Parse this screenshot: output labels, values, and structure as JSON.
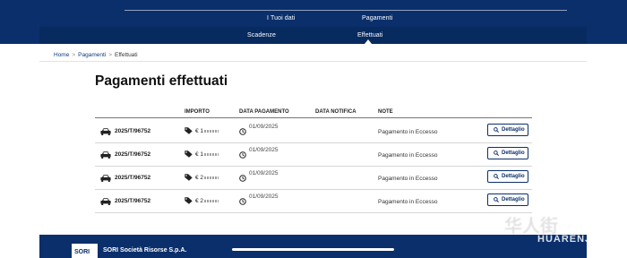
{
  "nav": {
    "top_links": [
      "I Tuoi dati",
      "Pagamenti"
    ],
    "sub_links": [
      "Scadenze",
      "Effettuati"
    ],
    "active_sub": "Effettuati"
  },
  "breadcrumb": [
    {
      "label": "Home",
      "link": true
    },
    {
      "label": "Pagamenti",
      "link": true
    },
    {
      "label": "Effettuati",
      "link": false
    }
  ],
  "page": {
    "title": "Pagamenti effettuati"
  },
  "table": {
    "columns": [
      "IMPORTO",
      "DATA PAGAMENTO",
      "DATA NOTIFICA",
      "NOTE"
    ],
    "rows": [
      {
        "plate": "2025/T/96752",
        "amount": "€ 1",
        "pay_date": "01/09/2025",
        "notify_date": "",
        "note": "Pagamento in Eccesso",
        "action": "Dettaglio"
      },
      {
        "plate": "2025/T/96752",
        "amount": "€ 1",
        "pay_date": "01/09/2025",
        "notify_date": "",
        "note": "Pagamento in Eccesso",
        "action": "Dettaglio"
      },
      {
        "plate": "2025/T/96752",
        "amount": "€ 2",
        "pay_date": "01/09/2025",
        "notify_date": "",
        "note": "Pagamento in Eccesso",
        "action": "Dettaglio"
      },
      {
        "plate": "2025/T/96752",
        "amount": "€ 2",
        "pay_date": "01/09/2025",
        "notify_date": "",
        "note": "Pagamento in Eccesso",
        "action": "Dettaglio"
      }
    ]
  },
  "footer": {
    "logo_text": "SORI",
    "company": "SORI Società Risorse S.p.A."
  },
  "watermark": {
    "name": "HUARENJIE",
    "glyphs": "华人街"
  },
  "colors": {
    "primary": "#0b2f6b",
    "link": "#0b3a80"
  }
}
